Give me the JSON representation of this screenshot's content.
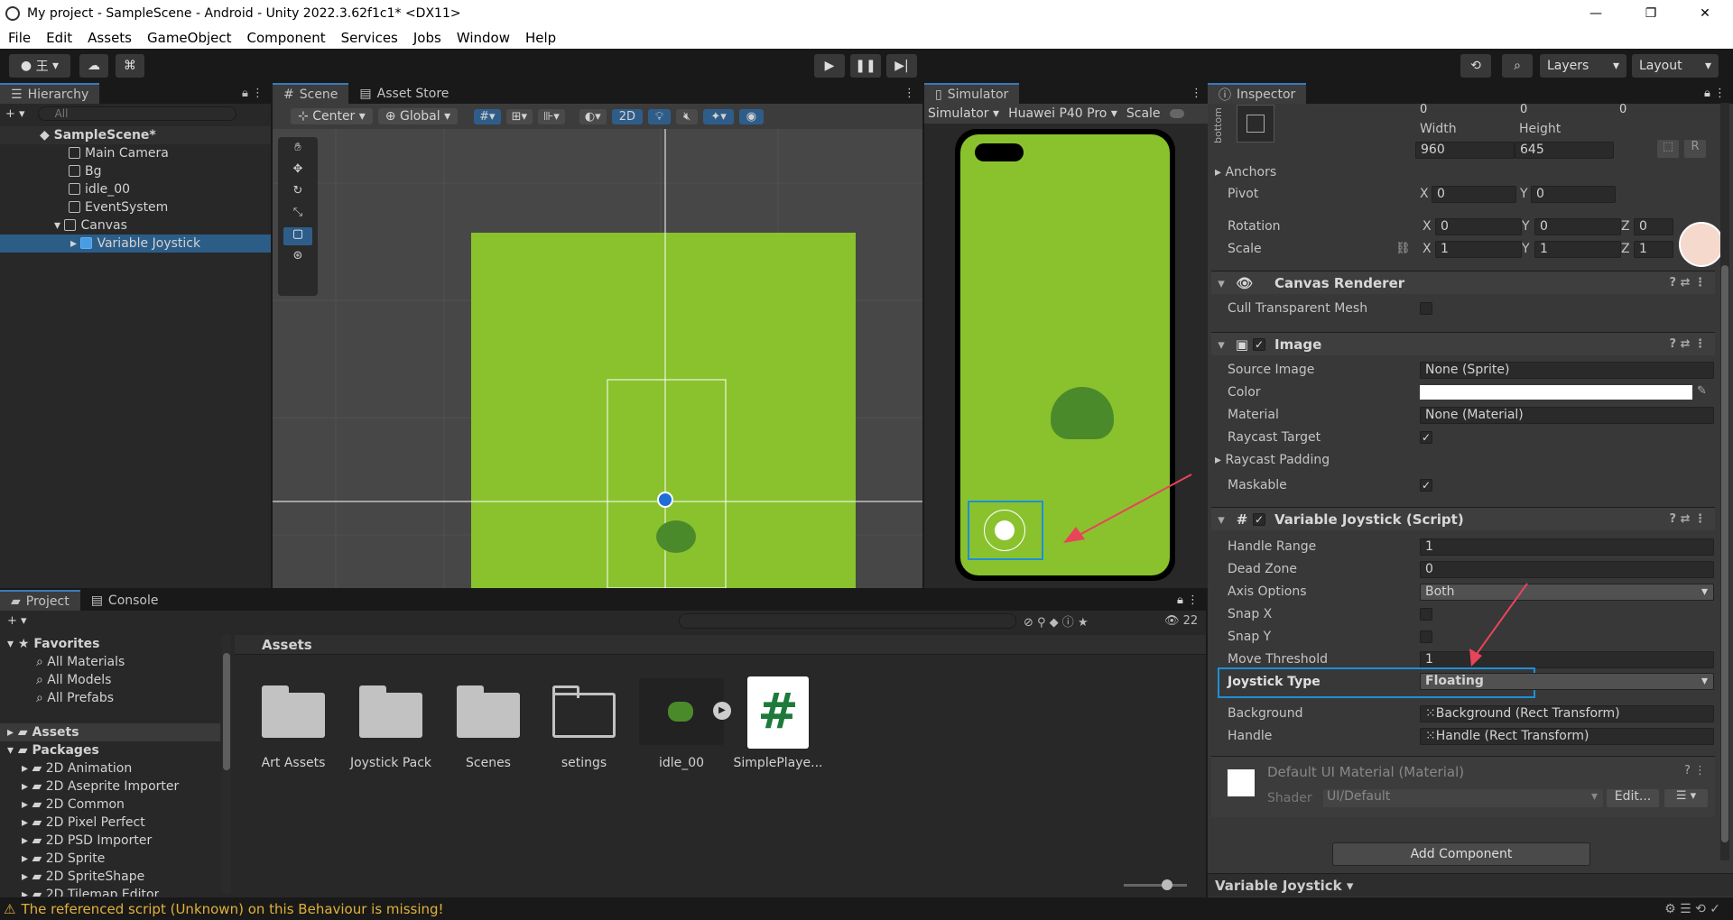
{
  "window": {
    "title": "My project - SampleScene - Android - Unity 2022.3.62f1c1* <DX11>",
    "minimize": "—",
    "maximize": "❐",
    "close": "✕"
  },
  "menu": [
    "File",
    "Edit",
    "Assets",
    "GameObject",
    "Component",
    "Services",
    "Jobs",
    "Window",
    "Help"
  ],
  "toolbar": {
    "layers": "Layers",
    "layout": "Layout",
    "account": "王"
  },
  "hierarchy": {
    "tab": "Hierarchy",
    "search_placeholder": "All",
    "scene": "SampleScene*",
    "items": [
      "Main Camera",
      "Bg",
      "idle_00",
      "EventSystem",
      "Canvas",
      "Variable Joystick"
    ]
  },
  "scene_view": {
    "tabs": [
      "Scene",
      "Asset Store"
    ],
    "pivot": "Center",
    "space": "Global",
    "mode2d": "2D"
  },
  "simulator": {
    "tab": "Simulator",
    "mode": "Simulator",
    "device": "Huawei P40 Pro",
    "scale": "Scale"
  },
  "inspector": {
    "tab": "Inspector",
    "rect": {
      "anchor_label": "bottom",
      "pos_values": [
        "0",
        "0",
        "0"
      ],
      "width_label": "Width",
      "height_label": "Height",
      "width": "960",
      "height": "645",
      "anchors": "Anchors",
      "pivot": "Pivot",
      "pivot_x": "0",
      "pivot_y": "0",
      "rotation": "Rotation",
      "rot_x": "0",
      "rot_y": "0",
      "rot_z": "0",
      "scale": "Scale",
      "scale_x": "1",
      "scale_y": "1",
      "scale_z": "1",
      "x": "X",
      "y": "Y",
      "z": "Z",
      "r": "R"
    },
    "canvas_renderer": {
      "title": "Canvas Renderer",
      "cull": "Cull Transparent Mesh"
    },
    "image": {
      "title": "Image",
      "source_image": "Source Image",
      "source_value": "None (Sprite)",
      "color": "Color",
      "material": "Material",
      "material_value": "None (Material)",
      "raycast_target": "Raycast Target",
      "raycast_padding": "Raycast Padding",
      "maskable": "Maskable"
    },
    "joystick": {
      "title": "Variable Joystick (Script)",
      "handle_range": "Handle Range",
      "handle_range_val": "1",
      "dead_zone": "Dead Zone",
      "dead_zone_val": "0",
      "axis_options": "Axis Options",
      "axis_val": "Both",
      "snap_x": "Snap X",
      "snap_y": "Snap Y",
      "move_threshold": "Move Threshold",
      "move_threshold_val": "1",
      "joystick_type": "Joystick Type",
      "joystick_type_val": "Floating",
      "background": "Background",
      "background_val": "Background (Rect Transform)",
      "handle": "Handle",
      "handle_val": "Handle (Rect Transform)"
    },
    "material": {
      "title": "Default UI Material (Material)",
      "shader": "Shader",
      "shader_val": "UI/Default",
      "edit": "Edit..."
    },
    "add_component": "Add Component",
    "footer": "Variable Joystick"
  },
  "project": {
    "tabs": [
      "Project",
      "Console"
    ],
    "count": "22",
    "favorites": "Favorites",
    "fav_items": [
      "All Materials",
      "All Models",
      "All Prefabs"
    ],
    "assets": "Assets",
    "packages": "Packages",
    "packages_items": [
      "2D Animation",
      "2D Aseprite Importer",
      "2D Common",
      "2D Pixel Perfect",
      "2D PSD Importer",
      "2D Sprite",
      "2D SpriteShape",
      "2D Tilemap Editor"
    ],
    "breadcrumb": "Assets",
    "files": [
      "Art Assets",
      "Joystick Pack",
      "Scenes",
      "setings",
      "idle_00",
      "SimplePlaye..."
    ]
  },
  "status": {
    "message": "The referenced script (Unknown) on this Behaviour is missing!"
  },
  "colors": {
    "accent": "#3a79bb",
    "green": "#8ac22e",
    "highlight": "#1e8fd6",
    "arrow": "#e8445a"
  }
}
